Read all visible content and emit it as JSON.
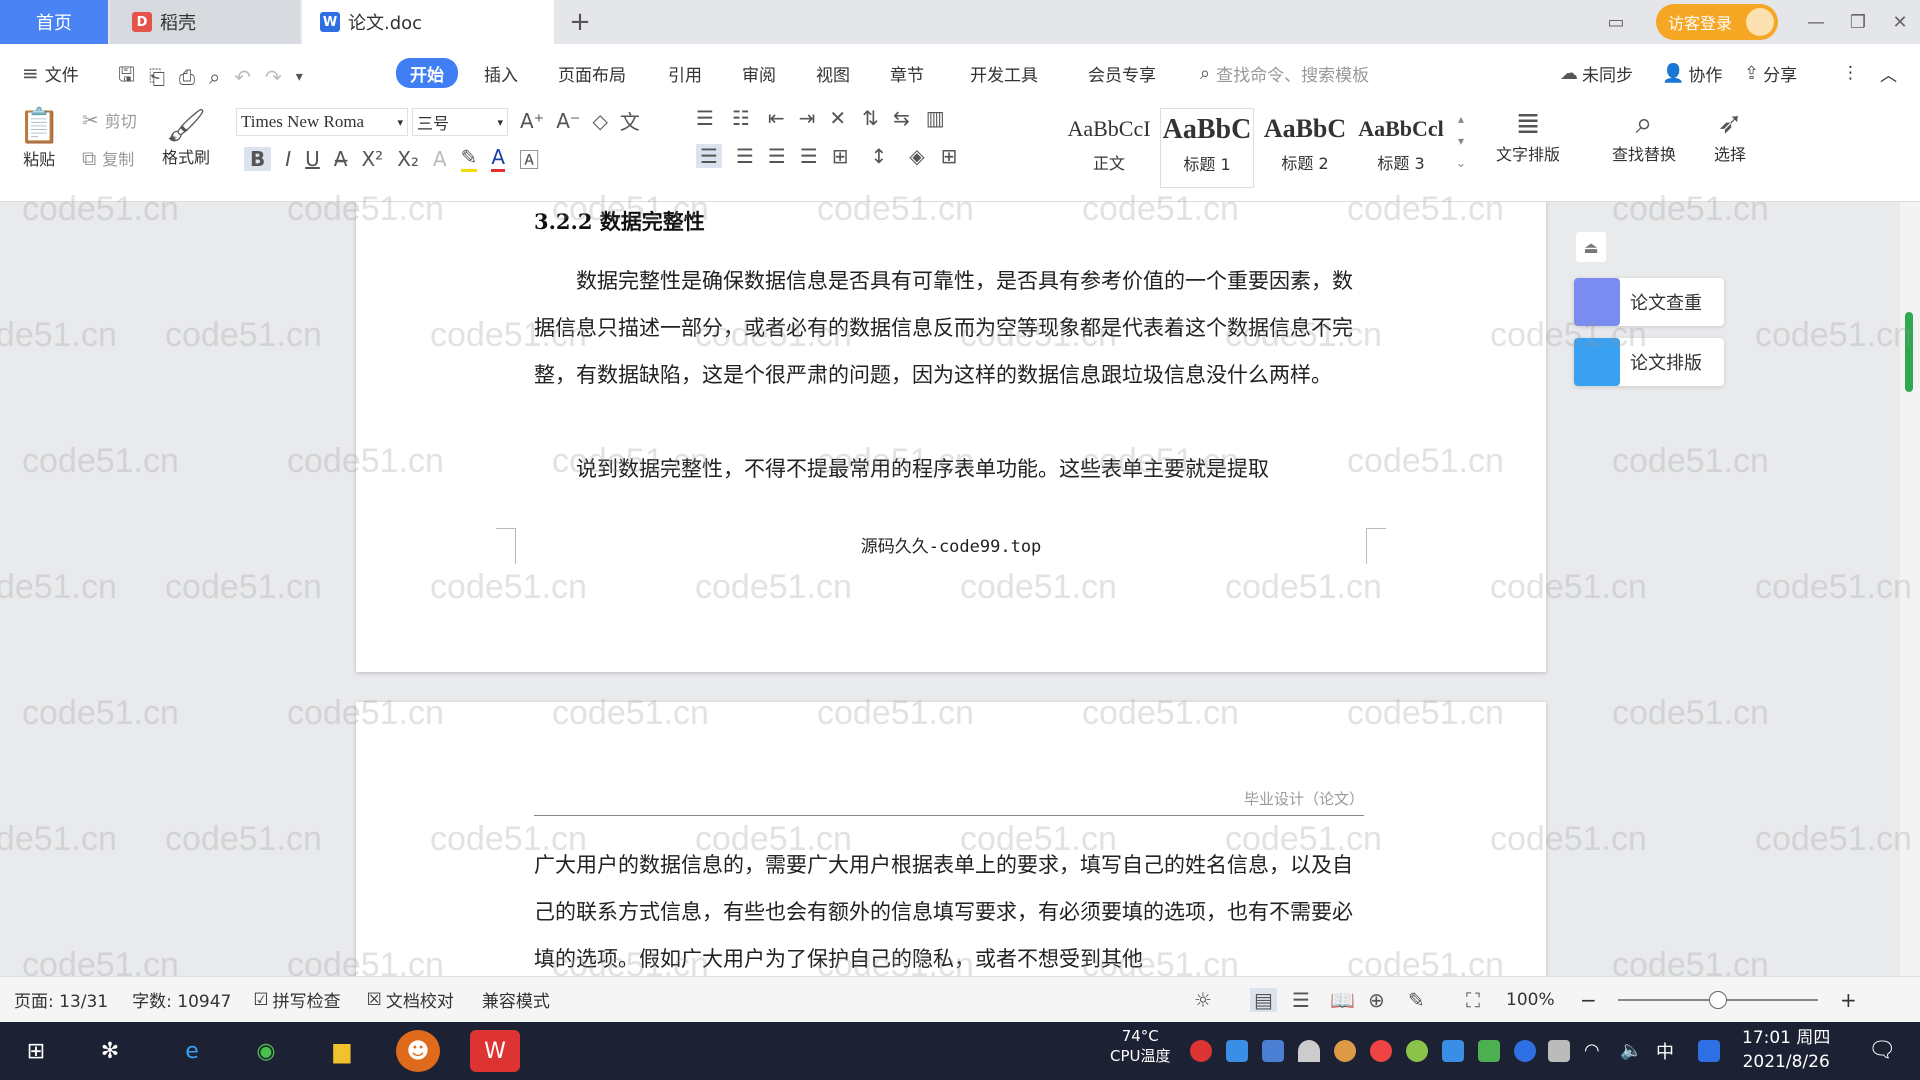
{
  "tabs": {
    "home": "首页",
    "daoke": "稻壳",
    "doc": "论文.doc",
    "new": "+"
  },
  "account": {
    "login": "访客登录"
  },
  "menu": [
    "文件",
    "开始",
    "插入",
    "页面布局",
    "引用",
    "审阅",
    "视图",
    "章节",
    "开发工具",
    "会员专享"
  ],
  "search": {
    "placeholder": "查找命令、搜索模板"
  },
  "right_actions": {
    "sync": "未同步",
    "collab": "协作",
    "share": "分享"
  },
  "clipboard": {
    "paste": "粘贴",
    "cut": "剪切",
    "copy": "复制",
    "format_painter": "格式刷"
  },
  "font": {
    "family": "Times New Roma",
    "size": "三号"
  },
  "styles": [
    {
      "preview": "AaBbCcI",
      "name": "正文"
    },
    {
      "preview": "AaBbC",
      "name": "标题 1"
    },
    {
      "preview": "AaBbC",
      "name": "标题 2"
    },
    {
      "preview": "AaBbCcl",
      "name": "标题 3"
    }
  ],
  "tools": {
    "text_layout": "文字排版",
    "find_replace": "查找替换",
    "select": "选择"
  },
  "document": {
    "heading": "3.2.2  数据完整性",
    "p1": "数据完整性是确保数据信息是否具有可靠性，是否具有参考价值的一个重要因素，数据信息只描述一部分，或者必有的数据信息反而为空等现象都是代表着这个数据信息不完整，有数据缺陷，这是个很严肃的问题，因为这样的数据信息跟垃圾信息没什么两样。",
    "p2": "说到数据完整性，不得不提最常用的程序表单功能。这些表单主要就是提取",
    "footer": "源码久久-code99.top",
    "header2": "毕业设计（论文）",
    "p3": "广大用户的数据信息的，需要广大用户根据表单上的要求，填写自己的姓名信息，以及自己的联系方式信息，有些也会有额外的信息填写要求，有必须要填的选项，也有不需要必填的选项。假如广大用户为了保护自己的隐私，或者不想受到其他"
  },
  "side_panel": {
    "check": "论文查重",
    "layout": "论文排版"
  },
  "status": {
    "page": "页面: 13/31",
    "words": "字数: 10947",
    "spell": "拼写检查",
    "proof": "文档校对",
    "compat": "兼容模式",
    "zoom": "100%",
    "zoom_level": 0.5
  },
  "taskbar": {
    "cpu_temp": "74°C",
    "cpu_label": "CPU温度",
    "ime": "中",
    "time": "17:01 周四",
    "date": "2021/8/26"
  },
  "watermark": "code51.cn",
  "colors": {
    "accent": "#3f7ff3",
    "login": "#f5a623",
    "taskbar": "#1c2233"
  }
}
